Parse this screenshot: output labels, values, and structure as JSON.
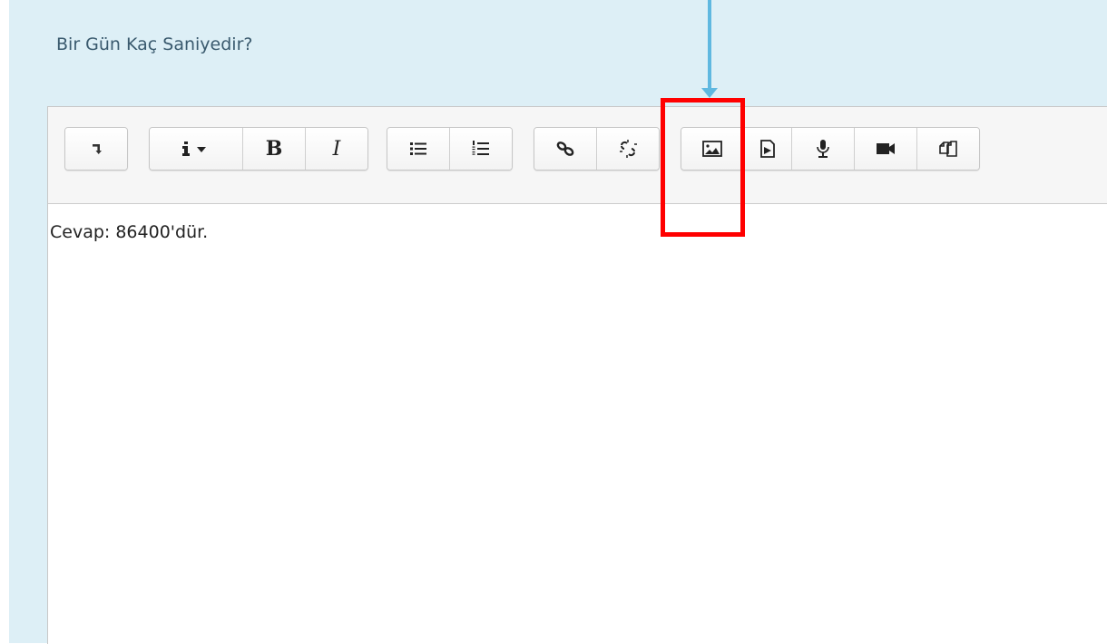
{
  "question": {
    "text": "Bir Gün Kaç Saniyedir?"
  },
  "editor": {
    "content": "Cevap: 86400'dür.",
    "toolbar": {
      "buttons": [
        {
          "name": "show-more-buttons",
          "icon": "toggle-arrow-icon"
        },
        {
          "name": "paragraph-styles",
          "icon": "info-icon"
        },
        {
          "name": "bold",
          "icon": "bold-icon",
          "label": "B"
        },
        {
          "name": "italic",
          "icon": "italic-icon",
          "label": "I"
        },
        {
          "name": "unordered-list",
          "icon": "unordered-list-icon"
        },
        {
          "name": "ordered-list",
          "icon": "ordered-list-icon"
        },
        {
          "name": "link",
          "icon": "link-icon"
        },
        {
          "name": "unlink",
          "icon": "unlink-icon"
        },
        {
          "name": "insert-image",
          "icon": "image-icon"
        },
        {
          "name": "insert-media",
          "icon": "media-file-icon"
        },
        {
          "name": "record-audio",
          "icon": "microphone-icon"
        },
        {
          "name": "record-video",
          "icon": "video-camera-icon"
        },
        {
          "name": "manage-files",
          "icon": "copy-files-icon"
        }
      ]
    }
  },
  "annotation": {
    "highlight_color": "#ff0000",
    "arrow_color": "#5fb8e0"
  },
  "colors": {
    "panel_bg": "#ddeff6",
    "question_text": "#3a5a6e",
    "toolbar_bg": "#f6f6f6"
  }
}
